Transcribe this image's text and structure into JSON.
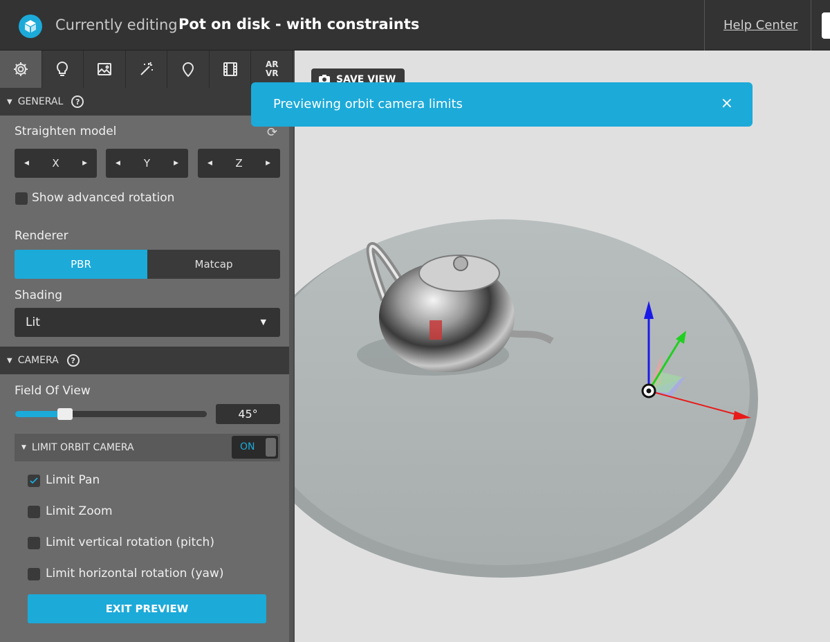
{
  "header": {
    "editing_label": "Currently editing",
    "model_name": "Pot on disk - with constraints",
    "help_link": "Help Center"
  },
  "tabs": [
    {
      "icon": "gear-icon"
    },
    {
      "icon": "lightbulb-icon"
    },
    {
      "icon": "image-icon"
    },
    {
      "icon": "magic-wand-icon"
    },
    {
      "icon": "location-pin-icon"
    },
    {
      "icon": "film-icon"
    },
    {
      "label_line1": "AR",
      "label_line2": "VR"
    }
  ],
  "general": {
    "title": "GENERAL",
    "straighten_label": "Straighten model",
    "axes": [
      "X",
      "Y",
      "Z"
    ],
    "advanced_rotation_label": "Show advanced rotation",
    "advanced_rotation_checked": false,
    "renderer_label": "Renderer",
    "renderer_options": [
      "PBR",
      "Matcap"
    ],
    "renderer_selected": "PBR",
    "shading_label": "Shading",
    "shading_value": "Lit"
  },
  "camera": {
    "title": "CAMERA",
    "fov_label": "Field Of View",
    "fov_value": "45°",
    "fov_fraction": 0.26,
    "limit_orbit_label": "LIMIT ORBIT CAMERA",
    "limit_orbit_toggle": "ON",
    "limits": [
      {
        "label": "Limit Pan",
        "checked": true
      },
      {
        "label": "Limit Zoom",
        "checked": false
      },
      {
        "label": "Limit vertical rotation (pitch)",
        "checked": false
      },
      {
        "label": "Limit horizontal rotation (yaw)",
        "checked": false
      }
    ],
    "exit_preview": "EXIT PREVIEW"
  },
  "viewport": {
    "save_view": "SAVE VIEW"
  },
  "toast": {
    "message": "Previewing orbit camera limits",
    "close": "×"
  },
  "colors": {
    "accent": "#1caad9",
    "topbar": "#333333",
    "sidebar": "#6b6b6b"
  }
}
